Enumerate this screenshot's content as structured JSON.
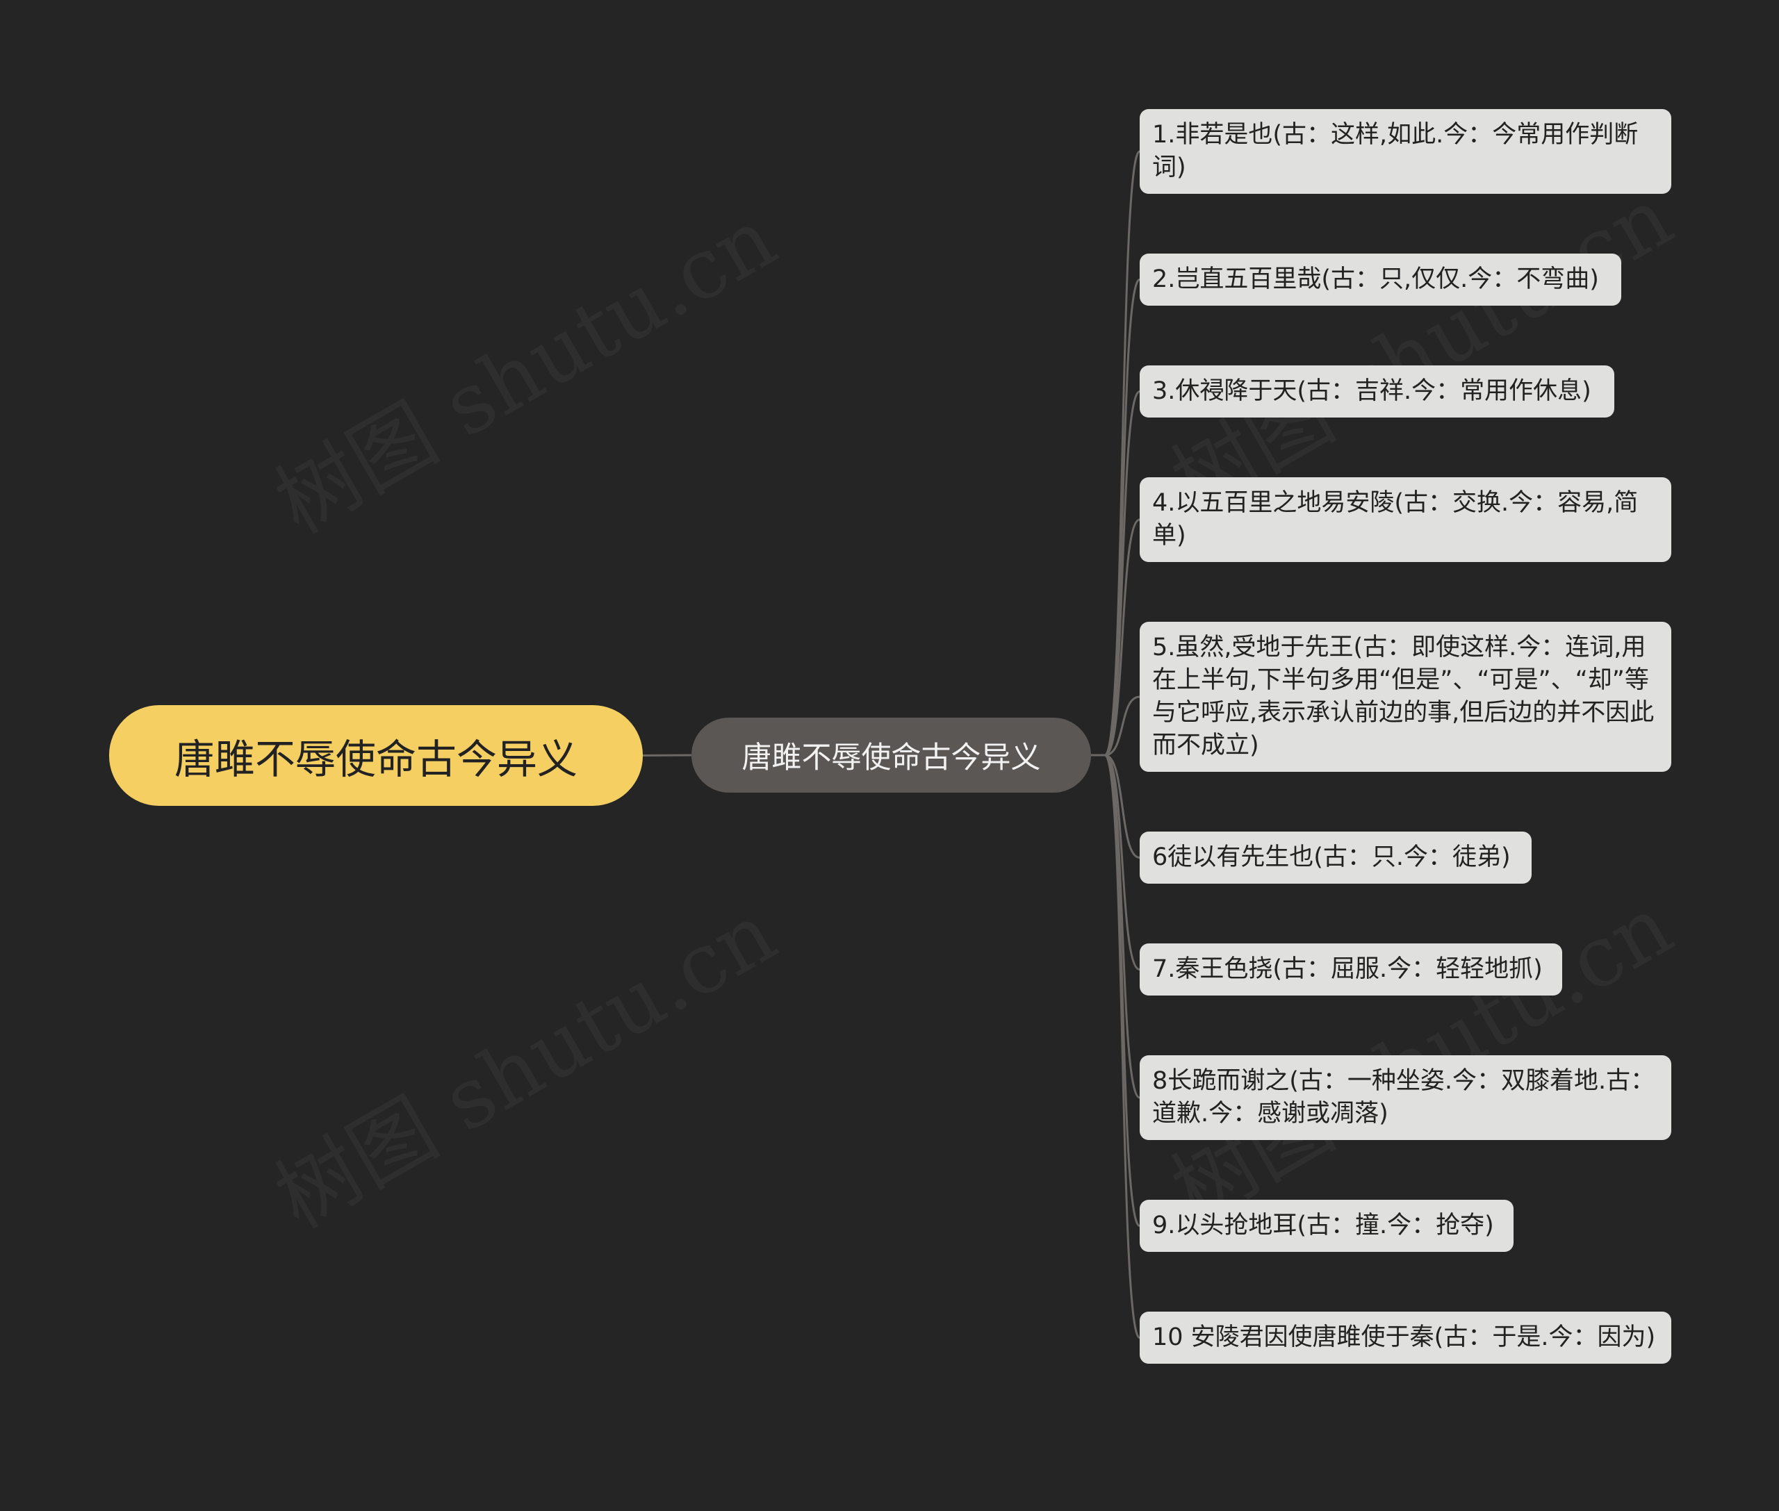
{
  "watermark": "树图 shutu.cn",
  "root": {
    "label": "唐雎不辱使命古今异义"
  },
  "center": {
    "label": "唐雎不辱使命古今异义"
  },
  "leaves": [
    "1.非若是也(古：这样,如此.今：今常用作判断词)",
    "2.岂直五百里哉(古：只,仅仅.今：不弯曲)",
    "3.休祲降于天(古：吉祥.今：常用作休息)",
    "4.以五百里之地易安陵(古：交换.今：容易,简单)",
    "5.虽然,受地于先王(古：即使这样.今：连词,用在上半句,下半句多用“但是”、“可是”、“却”等与它呼应,表示承认前边的事,但后边的并不因此而不成立)",
    "6徒以有先生也(古：只.今：徒弟)",
    "7.秦王色挠(古：屈服.今：轻轻地抓)",
    "8长跪而谢之(古：一种坐姿.今：双膝着地.古：道歉.今：感谢或凋落)",
    "9.以头抢地耳(古：撞.今：抢夺)",
    "10 安陵君因使唐雎使于秦(古：于是.今：因为)"
  ],
  "colors": {
    "background": "#252525",
    "root_fill": "#f5cf62",
    "center_fill": "#5a5755",
    "leaf_fill": "#e0e0df",
    "link": "#6b6866"
  }
}
